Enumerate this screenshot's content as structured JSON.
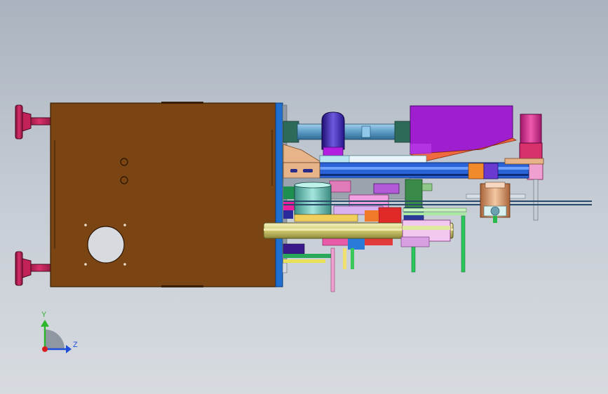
{
  "axes": {
    "y_label": "Y",
    "z_label": "Z",
    "y_color": "#2fb52f",
    "z_color": "#1f4fd8",
    "origin_color": "#d81f1f"
  },
  "colors": {
    "background_top": "#aab3bf",
    "background_bottom": "#d7dbe0",
    "housing": "#7a4512",
    "housing_edge": "#3a1f06",
    "frame_plate": "#1f6fd0",
    "handle": "#b0174a",
    "motor_cover": "#9f1fd0",
    "motor_cylinder": "#3a1fa0",
    "flywheel": "#d8d58a",
    "shaft": "#6aa3c8"
  }
}
